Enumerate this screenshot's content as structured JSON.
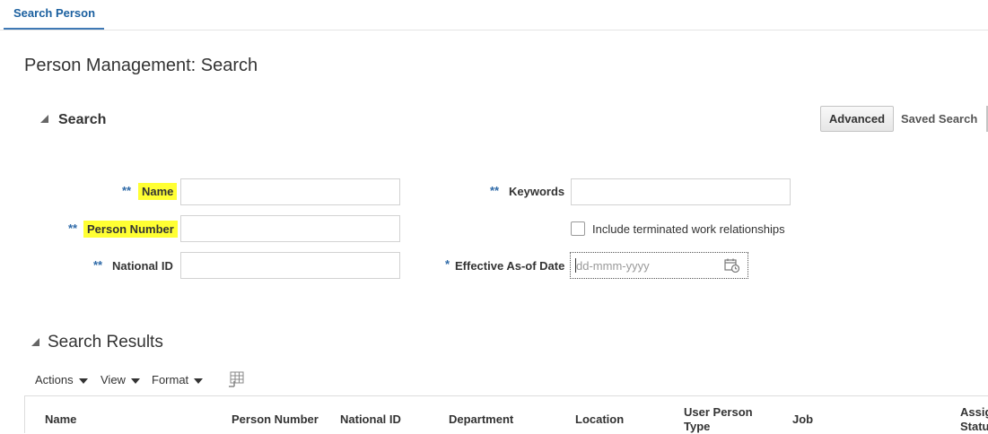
{
  "tab": {
    "label": "Search Person"
  },
  "page": {
    "title": "Person Management: Search"
  },
  "search": {
    "header": "Search",
    "advanced_label": "Advanced",
    "saved_search_label": "Saved Search",
    "required_marker": "**",
    "date_required_marker": "*",
    "fields": {
      "name": {
        "label": "Name",
        "value": ""
      },
      "person_number": {
        "label": "Person Number",
        "value": ""
      },
      "national_id": {
        "label": "National ID",
        "value": ""
      },
      "keywords": {
        "label": "Keywords",
        "value": ""
      },
      "include_terminated": {
        "label": "Include terminated work relationships",
        "checked": false
      },
      "effective_date": {
        "label": "Effective As-of Date",
        "placeholder": "dd-mmm-yyyy",
        "value": ""
      }
    },
    "highlight_color": "#ffff33"
  },
  "results": {
    "header": "Search Results",
    "toolbar": {
      "actions": "Actions",
      "view": "View",
      "format": "Format"
    },
    "columns": [
      "Name",
      "Person Number",
      "National ID",
      "Department",
      "Location",
      "User Person Type",
      "Job",
      "Assignment Status"
    ]
  },
  "colors": {
    "accent": "#1a5f9f",
    "required": "#2f6aa8"
  },
  "icons": {
    "calendar": "calendar-icon",
    "freeze": "freeze-columns-icon"
  }
}
